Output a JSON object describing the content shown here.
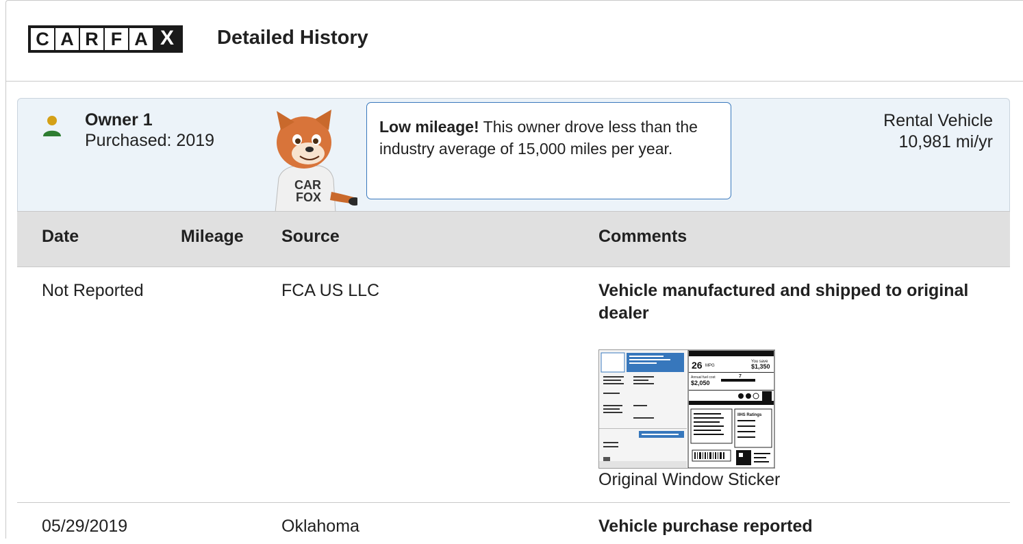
{
  "header": {
    "logo_letters": [
      "C",
      "A",
      "R",
      "F",
      "A",
      "X"
    ],
    "title": "Detailed History"
  },
  "owner": {
    "name": "Owner 1",
    "purchased": "Purchased: 2019",
    "callout_bold": "Low mileage!",
    "callout_text": " This owner drove less than the industry average of 15,000 miles per year.",
    "usage": "Rental Vehicle",
    "mileage_rate": "10,981 mi/yr",
    "mascot_shirt": [
      "CAR",
      "FOX"
    ]
  },
  "table": {
    "columns": [
      "Date",
      "Mileage",
      "Source",
      "Comments"
    ],
    "rows": [
      {
        "date": "Not Reported",
        "mileage": "",
        "source": "FCA US LLC",
        "comment": "Vehicle manufactured and shipped to original dealer",
        "attachment": "Original Window Sticker"
      },
      {
        "date": "05/29/2019",
        "mileage": "",
        "source": "Oklahoma",
        "comment": "Vehicle purchase reported"
      }
    ]
  },
  "sticker": {
    "mpg": "26",
    "mpg_unit": "MPG",
    "save_label": "You save",
    "save_value": "$1,350",
    "cost_label": "Annual fuel cost",
    "cost_value": "$2,050",
    "rating": "7",
    "iihs": "IIHS Ratings"
  },
  "colors": {
    "accent_blue": "#3777bc",
    "panel_bg": "#ecf3f9",
    "header_row_bg": "#e0e0e0",
    "person_head": "#d4a017",
    "person_body": "#2e7d32"
  }
}
